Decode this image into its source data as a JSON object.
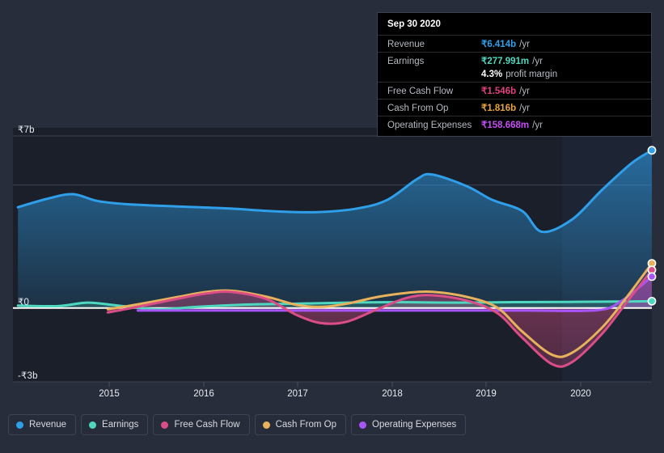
{
  "chart_data": {
    "type": "area",
    "title": "",
    "xlabel": "",
    "ylabel": "",
    "currency_symbol": "₹",
    "ylim": [
      -3,
      7
    ],
    "y_ticks": [
      {
        "label": "₹7b",
        "value": 7
      },
      {
        "label": "₹0",
        "value": 0
      },
      {
        "label": "-₹3b",
        "value": -3
      }
    ],
    "gridlines": [
      7,
      5,
      0,
      -3
    ],
    "x_ticks": [
      "2015",
      "2016",
      "2017",
      "2018",
      "2019",
      "2020"
    ],
    "x_range": [
      "2014.35",
      "2020.75"
    ],
    "grid": true,
    "legend_position": "bottom",
    "series": [
      {
        "name": "Revenue",
        "color": "#2f9fea",
        "filled": true,
        "points": [
          [
            2014.4,
            4.1
          ],
          [
            2014.7,
            4.45
          ],
          [
            2014.95,
            4.63
          ],
          [
            2015.2,
            4.35
          ],
          [
            2015.5,
            4.22
          ],
          [
            2016.0,
            4.13
          ],
          [
            2016.5,
            4.05
          ],
          [
            2017.0,
            3.93
          ],
          [
            2017.4,
            3.9
          ],
          [
            2017.8,
            4.05
          ],
          [
            2018.1,
            4.4
          ],
          [
            2018.4,
            5.25
          ],
          [
            2018.55,
            5.43
          ],
          [
            2018.9,
            4.95
          ],
          [
            2019.15,
            4.4
          ],
          [
            2019.45,
            3.95
          ],
          [
            2019.65,
            3.1
          ],
          [
            2019.95,
            3.6
          ],
          [
            2020.25,
            4.8
          ],
          [
            2020.55,
            5.9
          ],
          [
            2020.75,
            6.414
          ]
        ],
        "end_value": 6.414,
        "end_value_label": "₹6.414b"
      },
      {
        "name": "Earnings",
        "color": "#4fd8c0",
        "filled": true,
        "points": [
          [
            2014.4,
            0.1
          ],
          [
            2014.8,
            0.08
          ],
          [
            2015.1,
            0.22
          ],
          [
            2015.4,
            0.1
          ],
          [
            2015.8,
            -0.05
          ],
          [
            2016.2,
            0.05
          ],
          [
            2016.7,
            0.14
          ],
          [
            2017.2,
            0.18
          ],
          [
            2017.7,
            0.22
          ],
          [
            2018.2,
            0.24
          ],
          [
            2018.8,
            0.22
          ],
          [
            2019.4,
            0.24
          ],
          [
            2019.9,
            0.25
          ],
          [
            2020.3,
            0.26
          ],
          [
            2020.75,
            0.278
          ]
        ],
        "end_value": 0.277991,
        "end_value_label": "₹277.991m"
      },
      {
        "name": "Free Cash Flow",
        "color": "#db4d87",
        "filled": true,
        "points": [
          [
            2015.3,
            -0.18
          ],
          [
            2015.6,
            0.05
          ],
          [
            2016.0,
            0.38
          ],
          [
            2016.3,
            0.6
          ],
          [
            2016.55,
            0.65
          ],
          [
            2016.9,
            0.35
          ],
          [
            2017.2,
            -0.3
          ],
          [
            2017.45,
            -0.62
          ],
          [
            2017.7,
            -0.55
          ],
          [
            2018.0,
            -0.05
          ],
          [
            2018.3,
            0.42
          ],
          [
            2018.55,
            0.52
          ],
          [
            2018.9,
            0.3
          ],
          [
            2019.2,
            -0.2
          ],
          [
            2019.45,
            -1.2
          ],
          [
            2019.75,
            -2.28
          ],
          [
            2019.95,
            -2.2
          ],
          [
            2020.25,
            -1.05
          ],
          [
            2020.5,
            0.25
          ],
          [
            2020.75,
            1.546
          ]
        ],
        "end_value": 1.546,
        "end_value_label": "₹1.546b"
      },
      {
        "name": "Cash From Op",
        "color": "#e8b15c",
        "filled": false,
        "points": [
          [
            2015.3,
            -0.05
          ],
          [
            2015.6,
            0.15
          ],
          [
            2016.0,
            0.45
          ],
          [
            2016.3,
            0.66
          ],
          [
            2016.55,
            0.7
          ],
          [
            2016.9,
            0.45
          ],
          [
            2017.2,
            0.12
          ],
          [
            2017.45,
            0.05
          ],
          [
            2017.7,
            0.18
          ],
          [
            2018.0,
            0.45
          ],
          [
            2018.3,
            0.62
          ],
          [
            2018.55,
            0.66
          ],
          [
            2018.9,
            0.45
          ],
          [
            2019.2,
            0.02
          ],
          [
            2019.45,
            -0.95
          ],
          [
            2019.75,
            -1.9
          ],
          [
            2019.95,
            -1.82
          ],
          [
            2020.25,
            -0.8
          ],
          [
            2020.5,
            0.45
          ],
          [
            2020.75,
            1.816
          ]
        ],
        "end_value": 1.816,
        "end_value_label": "₹1.816b"
      },
      {
        "name": "Operating Expenses",
        "color": "#a855f7",
        "filled": false,
        "points": [
          [
            2015.6,
            -0.1
          ],
          [
            2016.5,
            -0.1
          ],
          [
            2017.5,
            -0.1
          ],
          [
            2018.5,
            -0.1
          ],
          [
            2019.5,
            -0.1
          ],
          [
            2020.2,
            -0.09
          ],
          [
            2020.45,
            0.3
          ],
          [
            2020.75,
            1.28
          ]
        ],
        "end_value": 0.158668,
        "end_value_label": "₹158.668m"
      }
    ],
    "highlight_region": {
      "from_x": 2019.85,
      "label": "forecast-region"
    }
  },
  "tooltip": {
    "date": "Sep 30 2020",
    "rows": [
      {
        "label": "Revenue",
        "value": "₹6.414b",
        "unit": "/yr",
        "color": "#2f9fea"
      },
      {
        "label": "Earnings",
        "value": "₹277.991m",
        "unit": "/yr",
        "color": "#4fd8c0"
      },
      {
        "label": "",
        "value": "4.3%",
        "unit": "profit margin",
        "color": "#ffffff"
      },
      {
        "label": "Free Cash Flow",
        "value": "₹1.546b",
        "unit": "/yr",
        "color": "#e0407f"
      },
      {
        "label": "Cash From Op",
        "value": "₹1.816b",
        "unit": "/yr",
        "color": "#e8a33c"
      },
      {
        "label": "Operating Expenses",
        "value": "₹158.668m",
        "unit": "/yr",
        "color": "#c44ff5"
      }
    ]
  },
  "legend": {
    "items": [
      {
        "label": "Revenue",
        "color": "#2f9fea"
      },
      {
        "label": "Earnings",
        "color": "#4fd8c0"
      },
      {
        "label": "Free Cash Flow",
        "color": "#db4d87"
      },
      {
        "label": "Cash From Op",
        "color": "#e8b15c"
      },
      {
        "label": "Operating Expenses",
        "color": "#a855f7"
      }
    ]
  }
}
